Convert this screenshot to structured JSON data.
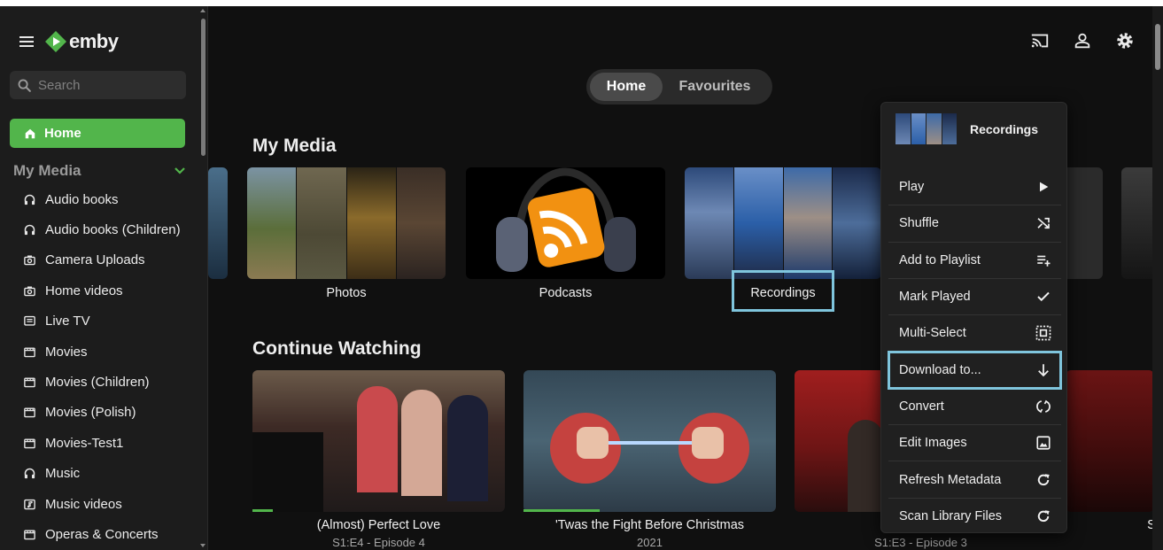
{
  "brand": {
    "name": "emby"
  },
  "search": {
    "placeholder": "Search"
  },
  "sidebar": {
    "home_label": "Home",
    "section_label": "My Media",
    "items": [
      {
        "label": "Audio books",
        "icon": "headphones-icon"
      },
      {
        "label": "Audio books (Children)",
        "icon": "headphones-icon"
      },
      {
        "label": "Camera Uploads",
        "icon": "camera-icon"
      },
      {
        "label": "Home videos",
        "icon": "camera-icon"
      },
      {
        "label": "Live TV",
        "icon": "tv-guide-icon"
      },
      {
        "label": "Movies",
        "icon": "film-icon"
      },
      {
        "label": "Movies (Children)",
        "icon": "film-icon"
      },
      {
        "label": "Movies (Polish)",
        "icon": "film-icon"
      },
      {
        "label": "Movies-Test1",
        "icon": "film-icon"
      },
      {
        "label": "Music",
        "icon": "headphones-icon"
      },
      {
        "label": "Music videos",
        "icon": "music-video-icon"
      },
      {
        "label": "Operas & Concerts",
        "icon": "film-icon"
      }
    ]
  },
  "header": {
    "tabs": [
      {
        "label": "Home",
        "active": true
      },
      {
        "label": "Favourites",
        "active": false
      }
    ],
    "icons": [
      "cast-icon",
      "user-icon",
      "settings-icon"
    ]
  },
  "my_media": {
    "title": "My Media",
    "cards": [
      {
        "label": "Photos"
      },
      {
        "label": "Podcasts"
      },
      {
        "label": "Recordings",
        "focused": true
      }
    ]
  },
  "continue_watching": {
    "title": "Continue Watching",
    "items": [
      {
        "title": "(Almost) Perfect Love",
        "subtitle": "S1:E4 - Episode 4",
        "progress": 0.08
      },
      {
        "title": "'Twas the Fight Before Christmas",
        "subtitle": "2021",
        "progress": 0.3
      },
      {
        "title": "",
        "subtitle": "S1:E3 - Episode 3",
        "progress": 0
      },
      {
        "title": "S",
        "subtitle": "",
        "progress": 0
      }
    ]
  },
  "context_menu": {
    "title": "Recordings",
    "items": [
      {
        "label": "Play",
        "icon": "play-icon"
      },
      {
        "label": "Shuffle",
        "icon": "shuffle-icon"
      },
      {
        "label": "Add to Playlist",
        "icon": "playlist-add-icon"
      },
      {
        "label": "Mark Played",
        "icon": "check-icon"
      },
      {
        "label": "Multi-Select",
        "icon": "select-all-icon"
      },
      {
        "label": "Download to...",
        "icon": "download-icon",
        "focused": true
      },
      {
        "label": "Convert",
        "icon": "convert-icon"
      },
      {
        "label": "Edit Images",
        "icon": "image-icon"
      },
      {
        "label": "Refresh Metadata",
        "icon": "refresh-icon"
      },
      {
        "label": "Scan Library Files",
        "icon": "refresh-icon"
      }
    ]
  },
  "colors": {
    "accent": "#52b54b",
    "focus": "#7fc5dd",
    "background": "#101010",
    "sidebar": "#1c1c1c"
  }
}
